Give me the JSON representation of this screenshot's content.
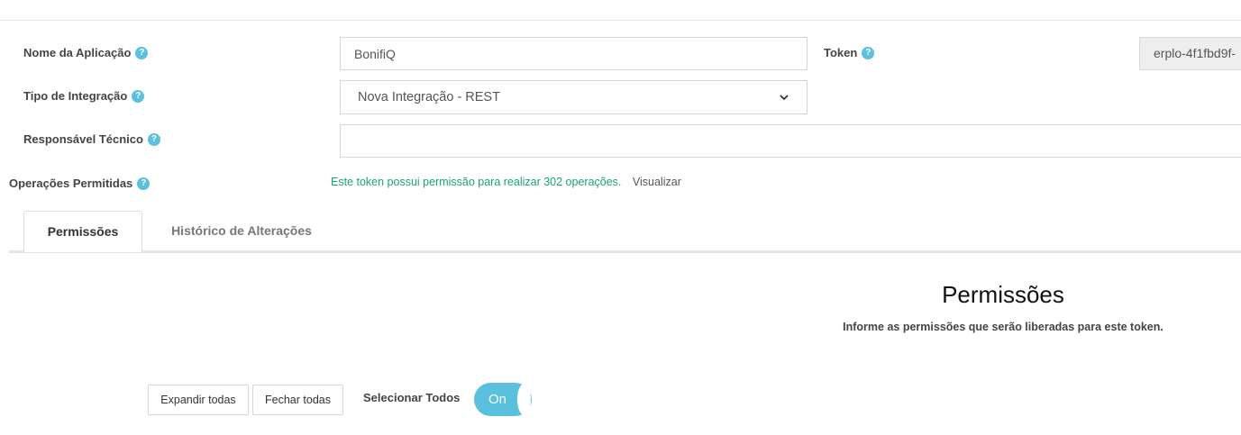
{
  "form": {
    "app_name_label": "Nome da Aplicação",
    "app_name_value": "BonifiQ",
    "token_label": "Token",
    "token_value": "erplo-4f1fbd9f-",
    "integration_type_label": "Tipo de Integração",
    "integration_type_value": "Nova Integração - REST",
    "tech_responsible_label": "Responsável Técnico",
    "tech_responsible_value": "",
    "ops_label": "Operações Permitidas",
    "ops_text": "Este token possui permissão para realizar 302 operações.",
    "ops_link": "Visualizar",
    "help_glyph": "?"
  },
  "tabs": [
    {
      "label": "Permissões",
      "active": true
    },
    {
      "label": "Histórico de Alterações",
      "active": false
    }
  ],
  "permissions": {
    "title": "Permissões",
    "subtitle": "Informe as permissões que serão liberadas para este token.",
    "expand_all": "Expandir todas",
    "collapse_all": "Fechar todas",
    "select_all_label": "Selecionar Todos",
    "toggle_label": "On",
    "toggle_on": true
  },
  "colors": {
    "accent": "#5bc0de",
    "ops_text": "#1aa37a"
  },
  "icons": [
    "question-circle-icon",
    "chevron-down-icon"
  ]
}
